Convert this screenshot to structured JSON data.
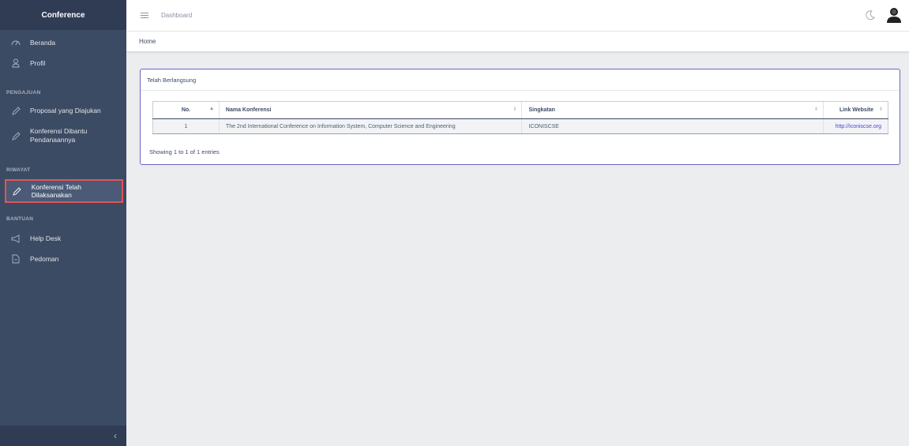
{
  "sidebar": {
    "brand": "Conference",
    "items": [
      {
        "label": "Beranda"
      },
      {
        "label": "Profil"
      }
    ],
    "section_pengajuan": "PENGAJUAN",
    "pengajuan_items": [
      {
        "label": "Proposal yang Diajukan"
      },
      {
        "label_line1": "Konferensi Dibantu",
        "label_line2": "Pendanaannya"
      }
    ],
    "section_riwayat": "RIWAYAT",
    "riwayat_items": [
      {
        "label": "Konferensi Telah Dilaksanakan"
      }
    ],
    "section_bantuan": "BANTUAN",
    "bantuan_items": [
      {
        "label": "Help Desk"
      },
      {
        "label": "Pedoman"
      }
    ],
    "toggler": "‹"
  },
  "header": {
    "link": "Dashboard"
  },
  "breadcrumb": "Home",
  "card": {
    "title": "Telah Berlangsung",
    "columns": [
      "No.",
      "Nama Konferensi",
      "Singkatan",
      "Link Website"
    ],
    "rows": [
      {
        "no": "1",
        "nama": "The 2nd International Conference on Information System, Computer Science and Engineering",
        "singkatan": "ICONISCSE",
        "link": "http://iconiscse.org"
      }
    ],
    "info": "Showing 1 to 1 of 1 entries"
  },
  "colors": {
    "sidebar": "#3c4b64",
    "active_border": "#e55353",
    "card_border": "#6c63c7",
    "link": "#4c46d6"
  }
}
